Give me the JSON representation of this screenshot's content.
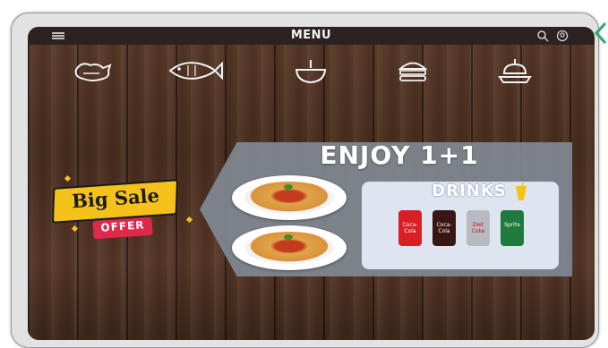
{
  "header": {
    "title": "MENU"
  },
  "categories": [
    "chicken-icon",
    "fish-icon",
    "soup-bowl-icon",
    "burger-icon",
    "dessert-icon"
  ],
  "promo": {
    "title": "ENJOY 1+1",
    "drinks_title": "DRINKS"
  },
  "drinks": [
    "Coca-Cola",
    "Coca-Cola",
    "Diet Coke",
    "Sprite"
  ],
  "sale": {
    "label": "Big Sale",
    "tag": "OFFER"
  },
  "colors": {
    "topbar": "#2b2221",
    "panel": "#7f8790",
    "drinks_box": "#dfe5f0",
    "sale_yellow": "#f5c21b",
    "offer_red": "#e0284b",
    "edge_arrow": "#2ea86b"
  }
}
